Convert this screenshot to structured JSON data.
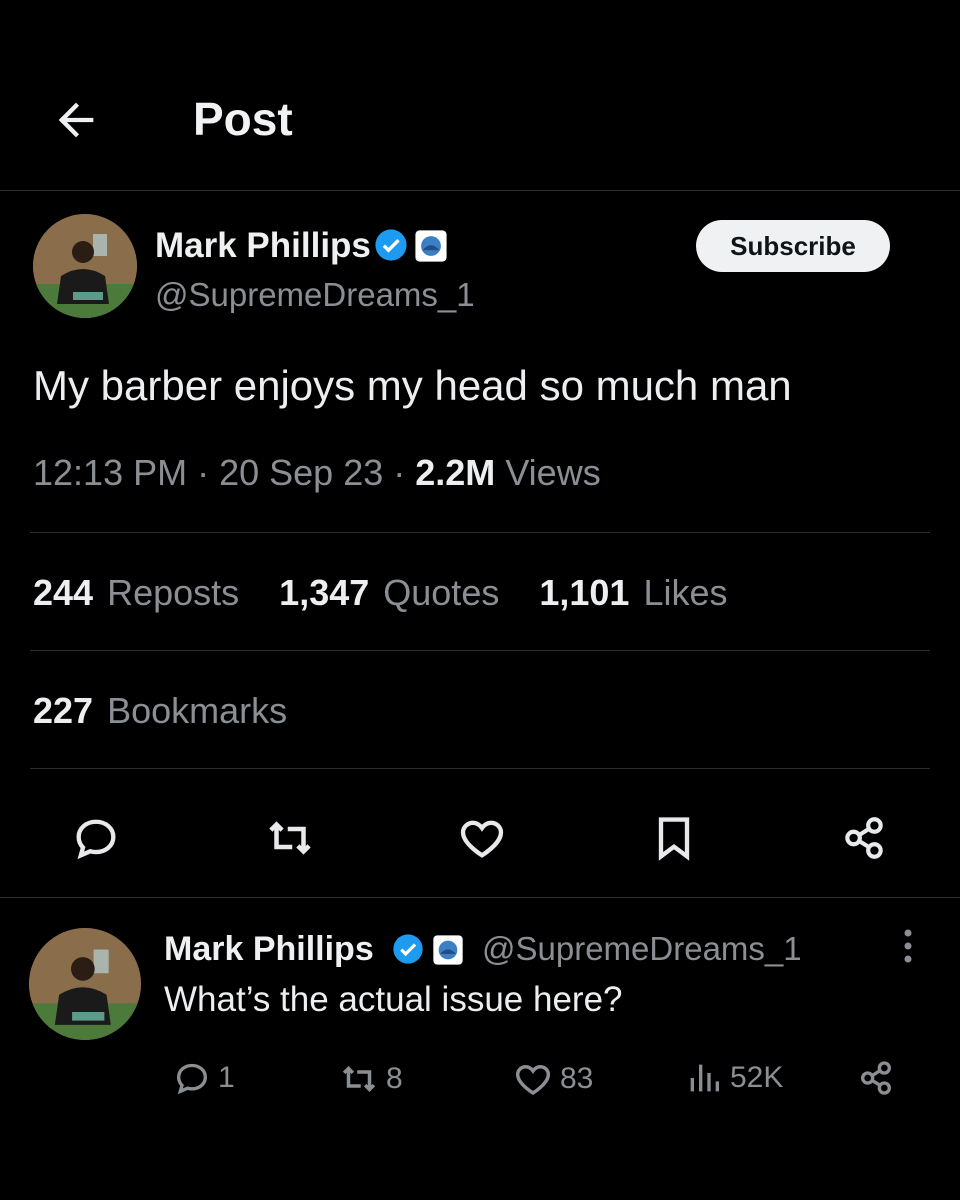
{
  "header": {
    "back_icon": "arrow-left-icon",
    "title": "Post"
  },
  "post": {
    "author_name": "Mark Phillips",
    "handle": "@SupremeDreams_1",
    "verified_icon": "verified-badge-icon",
    "affiliate_icon": "affiliate-badge-icon",
    "subscribe_label": "Subscribe",
    "text": "My barber enjoys my head so much man",
    "time": "12:13 PM",
    "date": "20 Sep 23",
    "views_count": "2.2M",
    "views_label": "Views",
    "reposts_count": "244",
    "reposts_label": "Reposts",
    "quotes_count": "1,347",
    "quotes_label": "Quotes",
    "likes_count": "1,101",
    "likes_label": "Likes",
    "bookmarks_count": "227",
    "bookmarks_label": "Bookmarks",
    "actions": [
      "reply-icon",
      "repost-icon",
      "like-icon",
      "bookmark-icon",
      "share-icon"
    ]
  },
  "reply": {
    "author_name": "Mark Phillips",
    "handle": "@SupremeDreams_1",
    "text": "What’s the actual issue here?",
    "replies": "1",
    "reposts": "8",
    "likes": "83",
    "views": "52K"
  },
  "colors": {
    "background": "#000000",
    "text": "#e7e9ea",
    "muted": "#8b8f94",
    "verified": "#1d9bf0",
    "divider": "#2a2d31"
  }
}
